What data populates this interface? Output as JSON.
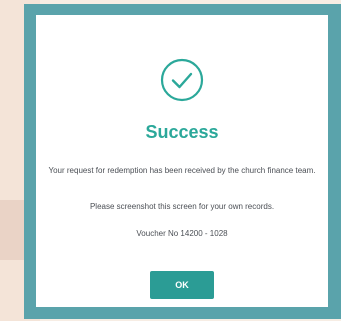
{
  "dialog": {
    "title": "Success",
    "message_line1": "Your request for redemption has been received by the church finance team.",
    "message_line2": "Please screenshot this screen for your own records.",
    "voucher": "Voucher No 14200 - 1028",
    "ok_label": "OK"
  },
  "icons": {
    "success": "check-circle-icon"
  },
  "colors": {
    "accent": "#2ba89a",
    "frame": "#5aa3ab",
    "button": "#2b9c95"
  }
}
